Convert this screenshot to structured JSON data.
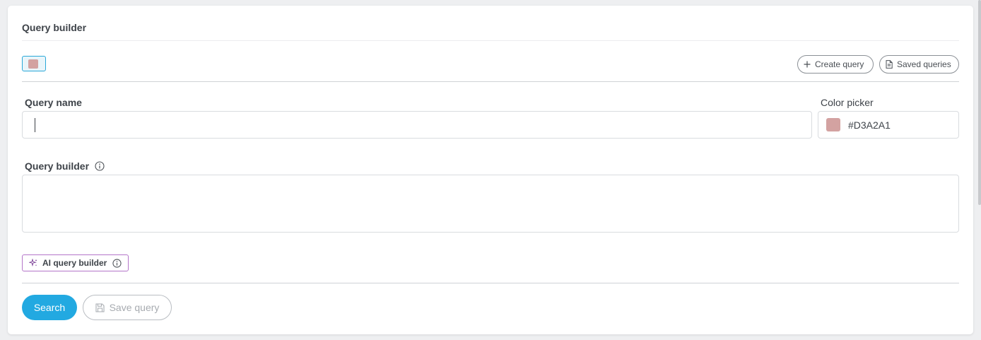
{
  "card": {
    "title": "Query builder"
  },
  "toolbar": {
    "create_label": "Create query",
    "saved_label": "Saved queries"
  },
  "form": {
    "query_name_label": "Query name",
    "query_name_value": "",
    "color_picker_label": "Color picker",
    "color_value": "#D3A2A1",
    "query_builder_label": "Query builder",
    "query_builder_value": ""
  },
  "ai_builder": {
    "label": "AI query builder"
  },
  "actions": {
    "search_label": "Search",
    "save_label": "Save query"
  },
  "colors": {
    "accent": "#22a9e1",
    "swatch": "#D3A2A1",
    "ai_border": "#b475c9"
  }
}
